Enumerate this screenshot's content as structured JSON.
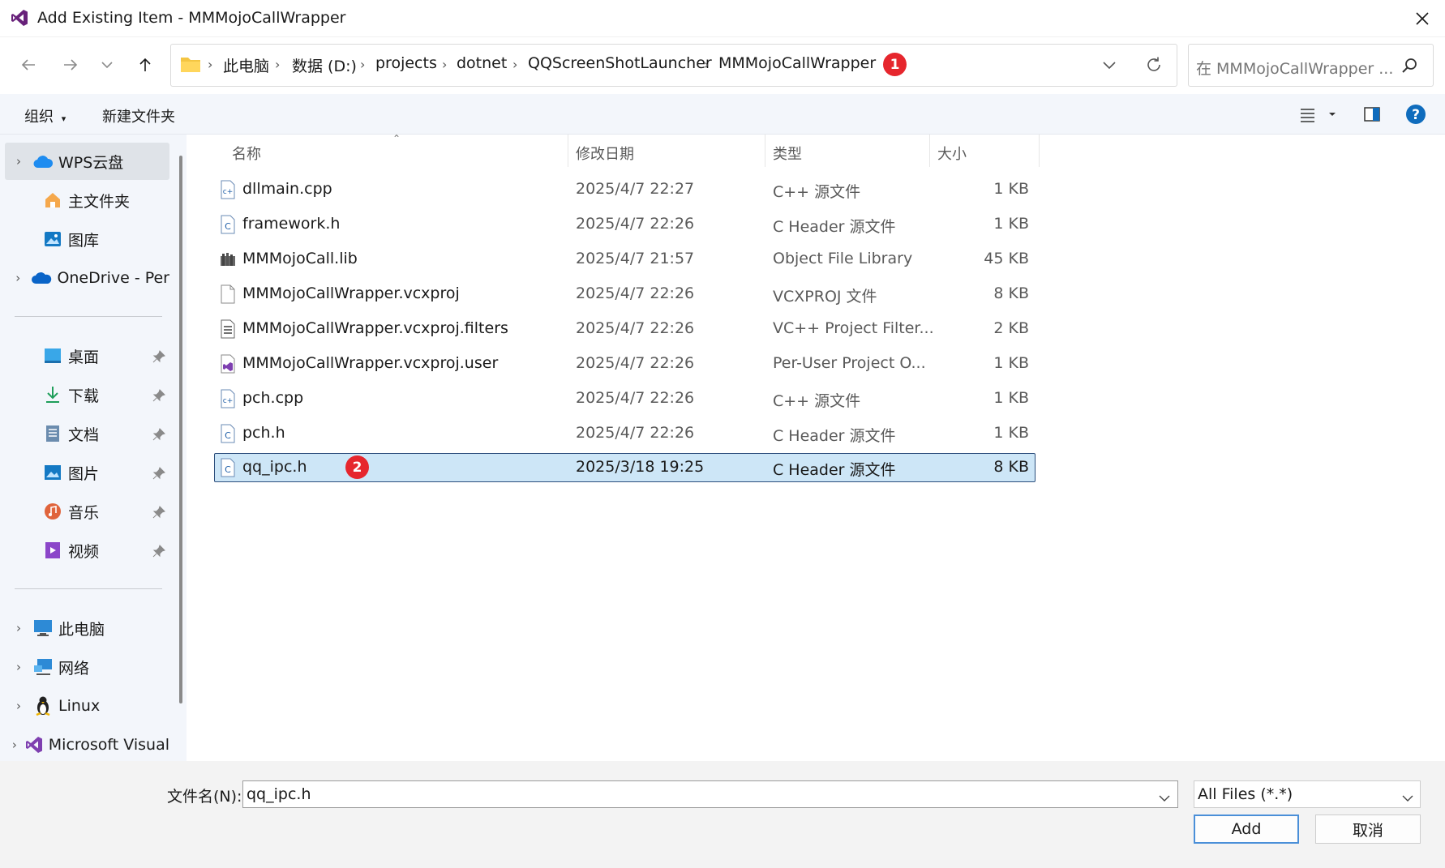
{
  "window": {
    "title": "Add Existing Item - MMMojoCallWrapper"
  },
  "breadcrumb": {
    "items": [
      "此电脑",
      "数据 (D:)",
      "projects",
      "dotnet",
      "QQScreenShotLauncher",
      "MMMojoCallWrapper"
    ],
    "badge": "1"
  },
  "search": {
    "placeholder": "在 MMMojoCallWrapper ..."
  },
  "toolbar": {
    "organize_label": "组织",
    "new_folder_label": "新建文件夹"
  },
  "sidebar": {
    "items": [
      {
        "label": "WPS云盘",
        "icon": "cloud-icon"
      },
      {
        "label": "主文件夹",
        "icon": "home-icon"
      },
      {
        "label": "图库",
        "icon": "gallery-icon"
      },
      {
        "label": "OneDrive - Per",
        "icon": "onedrive-icon"
      },
      {
        "label": "桌面",
        "icon": "desktop-icon"
      },
      {
        "label": "下载",
        "icon": "download-icon"
      },
      {
        "label": "文档",
        "icon": "document-icon"
      },
      {
        "label": "图片",
        "icon": "pictures-icon"
      },
      {
        "label": "音乐",
        "icon": "music-icon"
      },
      {
        "label": "视频",
        "icon": "video-icon"
      },
      {
        "label": "此电脑",
        "icon": "computer-icon"
      },
      {
        "label": "网络",
        "icon": "network-icon"
      },
      {
        "label": "Linux",
        "icon": "linux-icon"
      },
      {
        "label": "Microsoft Visual",
        "icon": "visual-studio-icon"
      }
    ]
  },
  "columns": {
    "name": "名称",
    "modified": "修改日期",
    "type": "类型",
    "size": "大小"
  },
  "files": [
    {
      "name": "dllmain.cpp",
      "modified": "2025/4/7 22:27",
      "type": "C++ 源文件",
      "size": "1 KB",
      "icon": "cpp-file-icon"
    },
    {
      "name": "framework.h",
      "modified": "2025/4/7 22:26",
      "type": "C Header 源文件",
      "size": "1 KB",
      "icon": "header-file-icon"
    },
    {
      "name": "MMMojoCall.lib",
      "modified": "2025/4/7 21:57",
      "type": "Object File Library",
      "size": "45 KB",
      "icon": "lib-file-icon"
    },
    {
      "name": "MMMojoCallWrapper.vcxproj",
      "modified": "2025/4/7 22:26",
      "type": "VCXPROJ 文件",
      "size": "8 KB",
      "icon": "blank-file-icon"
    },
    {
      "name": "MMMojoCallWrapper.vcxproj.filters",
      "modified": "2025/4/7 22:26",
      "type": "VC++ Project Filter...",
      "size": "2 KB",
      "icon": "filters-file-icon"
    },
    {
      "name": "MMMojoCallWrapper.vcxproj.user",
      "modified": "2025/4/7 22:26",
      "type": "Per-User Project O...",
      "size": "1 KB",
      "icon": "vs-user-file-icon"
    },
    {
      "name": "pch.cpp",
      "modified": "2025/4/7 22:26",
      "type": "C++ 源文件",
      "size": "1 KB",
      "icon": "cpp-file-icon"
    },
    {
      "name": "pch.h",
      "modified": "2025/4/7 22:26",
      "type": "C Header 源文件",
      "size": "1 KB",
      "icon": "header-file-icon"
    },
    {
      "name": "qq_ipc.h",
      "modified": "2025/3/18 19:25",
      "type": "C Header 源文件",
      "size": "8 KB",
      "icon": "header-file-icon",
      "selected": true,
      "badge": "2"
    }
  ],
  "bottom": {
    "filename_label": "文件名(N):",
    "filename_value": "qq_ipc.h",
    "filter_value": "All Files (*.*)",
    "add_label": "Add",
    "cancel_label": "取消"
  },
  "colors": {
    "accent": "#0f6cbd",
    "selection": "#cde6f7",
    "badge": "#e6262d"
  }
}
